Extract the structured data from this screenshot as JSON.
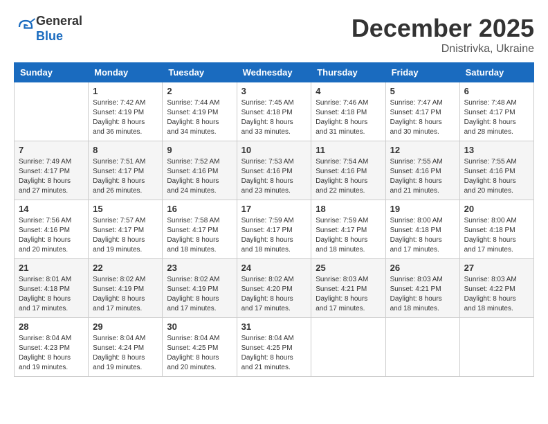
{
  "header": {
    "logo_line1": "General",
    "logo_line2": "Blue",
    "month": "December 2025",
    "location": "Dnistrivka, Ukraine"
  },
  "weekdays": [
    "Sunday",
    "Monday",
    "Tuesday",
    "Wednesday",
    "Thursday",
    "Friday",
    "Saturday"
  ],
  "weeks": [
    [
      {
        "day": "",
        "info": ""
      },
      {
        "day": "1",
        "info": "Sunrise: 7:42 AM\nSunset: 4:19 PM\nDaylight: 8 hours\nand 36 minutes."
      },
      {
        "day": "2",
        "info": "Sunrise: 7:44 AM\nSunset: 4:19 PM\nDaylight: 8 hours\nand 34 minutes."
      },
      {
        "day": "3",
        "info": "Sunrise: 7:45 AM\nSunset: 4:18 PM\nDaylight: 8 hours\nand 33 minutes."
      },
      {
        "day": "4",
        "info": "Sunrise: 7:46 AM\nSunset: 4:18 PM\nDaylight: 8 hours\nand 31 minutes."
      },
      {
        "day": "5",
        "info": "Sunrise: 7:47 AM\nSunset: 4:17 PM\nDaylight: 8 hours\nand 30 minutes."
      },
      {
        "day": "6",
        "info": "Sunrise: 7:48 AM\nSunset: 4:17 PM\nDaylight: 8 hours\nand 28 minutes."
      }
    ],
    [
      {
        "day": "7",
        "info": "Sunrise: 7:49 AM\nSunset: 4:17 PM\nDaylight: 8 hours\nand 27 minutes."
      },
      {
        "day": "8",
        "info": "Sunrise: 7:51 AM\nSunset: 4:17 PM\nDaylight: 8 hours\nand 26 minutes."
      },
      {
        "day": "9",
        "info": "Sunrise: 7:52 AM\nSunset: 4:16 PM\nDaylight: 8 hours\nand 24 minutes."
      },
      {
        "day": "10",
        "info": "Sunrise: 7:53 AM\nSunset: 4:16 PM\nDaylight: 8 hours\nand 23 minutes."
      },
      {
        "day": "11",
        "info": "Sunrise: 7:54 AM\nSunset: 4:16 PM\nDaylight: 8 hours\nand 22 minutes."
      },
      {
        "day": "12",
        "info": "Sunrise: 7:55 AM\nSunset: 4:16 PM\nDaylight: 8 hours\nand 21 minutes."
      },
      {
        "day": "13",
        "info": "Sunrise: 7:55 AM\nSunset: 4:16 PM\nDaylight: 8 hours\nand 20 minutes."
      }
    ],
    [
      {
        "day": "14",
        "info": "Sunrise: 7:56 AM\nSunset: 4:16 PM\nDaylight: 8 hours\nand 20 minutes."
      },
      {
        "day": "15",
        "info": "Sunrise: 7:57 AM\nSunset: 4:17 PM\nDaylight: 8 hours\nand 19 minutes."
      },
      {
        "day": "16",
        "info": "Sunrise: 7:58 AM\nSunset: 4:17 PM\nDaylight: 8 hours\nand 18 minutes."
      },
      {
        "day": "17",
        "info": "Sunrise: 7:59 AM\nSunset: 4:17 PM\nDaylight: 8 hours\nand 18 minutes."
      },
      {
        "day": "18",
        "info": "Sunrise: 7:59 AM\nSunset: 4:17 PM\nDaylight: 8 hours\nand 18 minutes."
      },
      {
        "day": "19",
        "info": "Sunrise: 8:00 AM\nSunset: 4:18 PM\nDaylight: 8 hours\nand 17 minutes."
      },
      {
        "day": "20",
        "info": "Sunrise: 8:00 AM\nSunset: 4:18 PM\nDaylight: 8 hours\nand 17 minutes."
      }
    ],
    [
      {
        "day": "21",
        "info": "Sunrise: 8:01 AM\nSunset: 4:18 PM\nDaylight: 8 hours\nand 17 minutes."
      },
      {
        "day": "22",
        "info": "Sunrise: 8:02 AM\nSunset: 4:19 PM\nDaylight: 8 hours\nand 17 minutes."
      },
      {
        "day": "23",
        "info": "Sunrise: 8:02 AM\nSunset: 4:19 PM\nDaylight: 8 hours\nand 17 minutes."
      },
      {
        "day": "24",
        "info": "Sunrise: 8:02 AM\nSunset: 4:20 PM\nDaylight: 8 hours\nand 17 minutes."
      },
      {
        "day": "25",
        "info": "Sunrise: 8:03 AM\nSunset: 4:21 PM\nDaylight: 8 hours\nand 17 minutes."
      },
      {
        "day": "26",
        "info": "Sunrise: 8:03 AM\nSunset: 4:21 PM\nDaylight: 8 hours\nand 18 minutes."
      },
      {
        "day": "27",
        "info": "Sunrise: 8:03 AM\nSunset: 4:22 PM\nDaylight: 8 hours\nand 18 minutes."
      }
    ],
    [
      {
        "day": "28",
        "info": "Sunrise: 8:04 AM\nSunset: 4:23 PM\nDaylight: 8 hours\nand 19 minutes."
      },
      {
        "day": "29",
        "info": "Sunrise: 8:04 AM\nSunset: 4:24 PM\nDaylight: 8 hours\nand 19 minutes."
      },
      {
        "day": "30",
        "info": "Sunrise: 8:04 AM\nSunset: 4:25 PM\nDaylight: 8 hours\nand 20 minutes."
      },
      {
        "day": "31",
        "info": "Sunrise: 8:04 AM\nSunset: 4:25 PM\nDaylight: 8 hours\nand 21 minutes."
      },
      {
        "day": "",
        "info": ""
      },
      {
        "day": "",
        "info": ""
      },
      {
        "day": "",
        "info": ""
      }
    ]
  ]
}
